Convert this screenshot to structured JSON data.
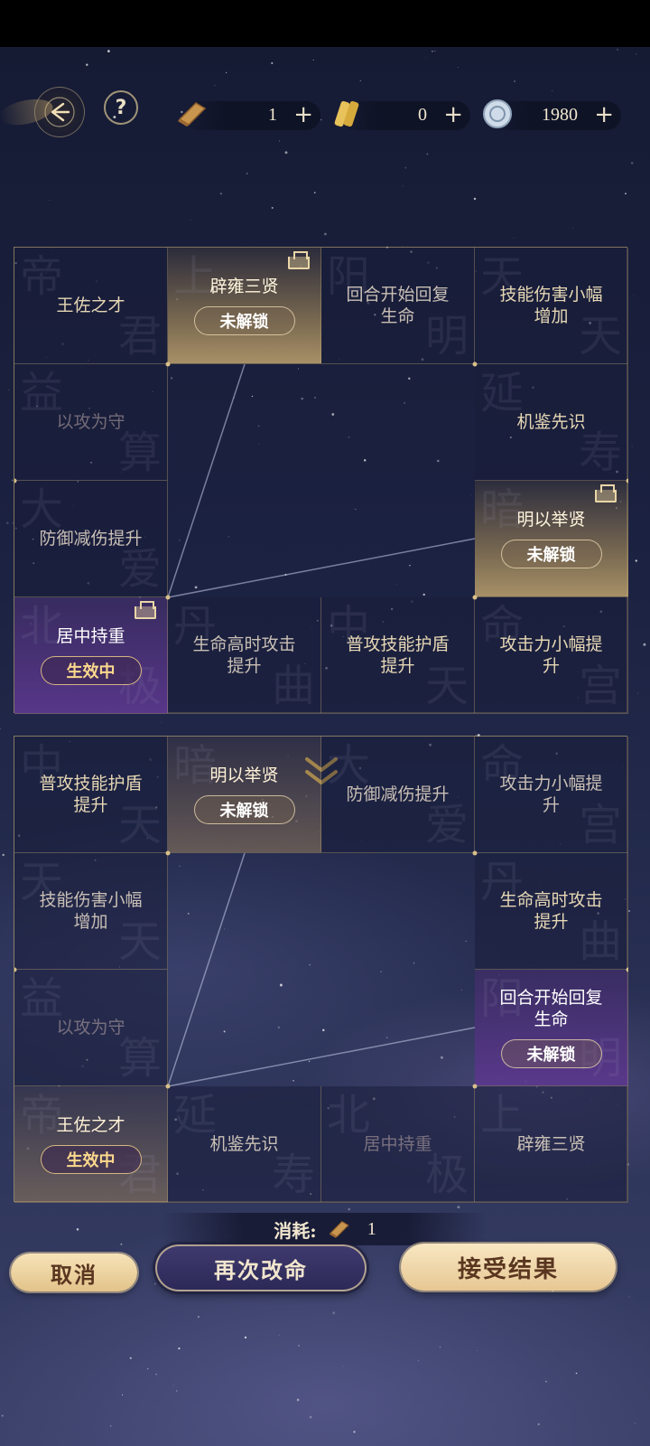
{
  "resources": [
    {
      "icon": "scroll-icon",
      "value": "1",
      "plus": "+"
    },
    {
      "icon": "gold-token-icon",
      "value": "0",
      "plus": "+"
    },
    {
      "icon": "silver-coin-icon",
      "value": "1980",
      "plus": "+"
    }
  ],
  "help_label": "?",
  "grid_top": {
    "cells": [
      {
        "label": "王佐之才",
        "wm1": "帝",
        "wm2": "君",
        "style": "normal"
      },
      {
        "label": "辟雍三贤",
        "wm1": "上",
        "wm2": "",
        "style": "gold",
        "badge": "未解锁",
        "lock": true
      },
      {
        "label": "回合开始回复生命",
        "wm1": "阳",
        "wm2": "明",
        "style": "muted"
      },
      {
        "label": "技能伤害小幅增加",
        "wm1": "天",
        "wm2": "天",
        "style": "normal"
      },
      {
        "label": "以攻为守",
        "wm1": "益",
        "wm2": "算",
        "style": "dim"
      },
      {
        "label": "机鉴先识",
        "wm1": "延",
        "wm2": "寿",
        "style": "normal"
      },
      {
        "label": "防御减伤提升",
        "wm1": "大",
        "wm2": "爱",
        "style": "muted"
      },
      {
        "label": "明以举贤",
        "wm1": "暗",
        "wm2": "",
        "style": "gold",
        "badge": "未解锁",
        "lock": true
      },
      {
        "label": "居中持重",
        "wm1": "北",
        "wm2": "极",
        "style": "purple",
        "badge": "生效中",
        "lock": true,
        "active": true
      },
      {
        "label": "生命高时攻击提升",
        "wm1": "丹",
        "wm2": "曲",
        "style": "muted"
      },
      {
        "label": "普攻技能护盾提升",
        "wm1": "中",
        "wm2": "天",
        "style": "normal"
      },
      {
        "label": "攻击力小幅提升",
        "wm1": "命",
        "wm2": "宫",
        "style": "normal"
      }
    ]
  },
  "grid_bottom": {
    "cells": [
      {
        "label": "普攻技能护盾提升",
        "wm1": "中",
        "wm2": "天",
        "style": "normal"
      },
      {
        "label": "明以举贤",
        "wm1": "暗",
        "wm2": "",
        "style": "goldfaint",
        "badge": "未解锁"
      },
      {
        "label": "防御减伤提升",
        "wm1": "大",
        "wm2": "爱",
        "style": "muted"
      },
      {
        "label": "攻击力小幅提升",
        "wm1": "命",
        "wm2": "宫",
        "style": "muted"
      },
      {
        "label": "技能伤害小幅增加",
        "wm1": "天",
        "wm2": "天",
        "style": "muted"
      },
      {
        "label": "生命高时攻击提升",
        "wm1": "丹",
        "wm2": "曲",
        "style": "normal"
      },
      {
        "label": "以攻为守",
        "wm1": "益",
        "wm2": "算",
        "style": "dim"
      },
      {
        "label": "回合开始回复生命",
        "wm1": "阳",
        "wm2": "明",
        "style": "purple",
        "badge": "未解锁"
      },
      {
        "label": "王佐之才",
        "wm1": "帝",
        "wm2": "君",
        "style": "goldfaint",
        "badge": "生效中",
        "active": true
      },
      {
        "label": "机鉴先识",
        "wm1": "延",
        "wm2": "寿",
        "style": "muted"
      },
      {
        "label": "居中持重",
        "wm1": "北",
        "wm2": "极",
        "style": "dim"
      },
      {
        "label": "辟雍三贤",
        "wm1": "上",
        "wm2": "",
        "style": "muted"
      }
    ]
  },
  "cost": {
    "label": "消耗:",
    "value": "1"
  },
  "buttons": {
    "cancel": "取消",
    "reroll": "再次改命",
    "accept": "接受结果"
  }
}
